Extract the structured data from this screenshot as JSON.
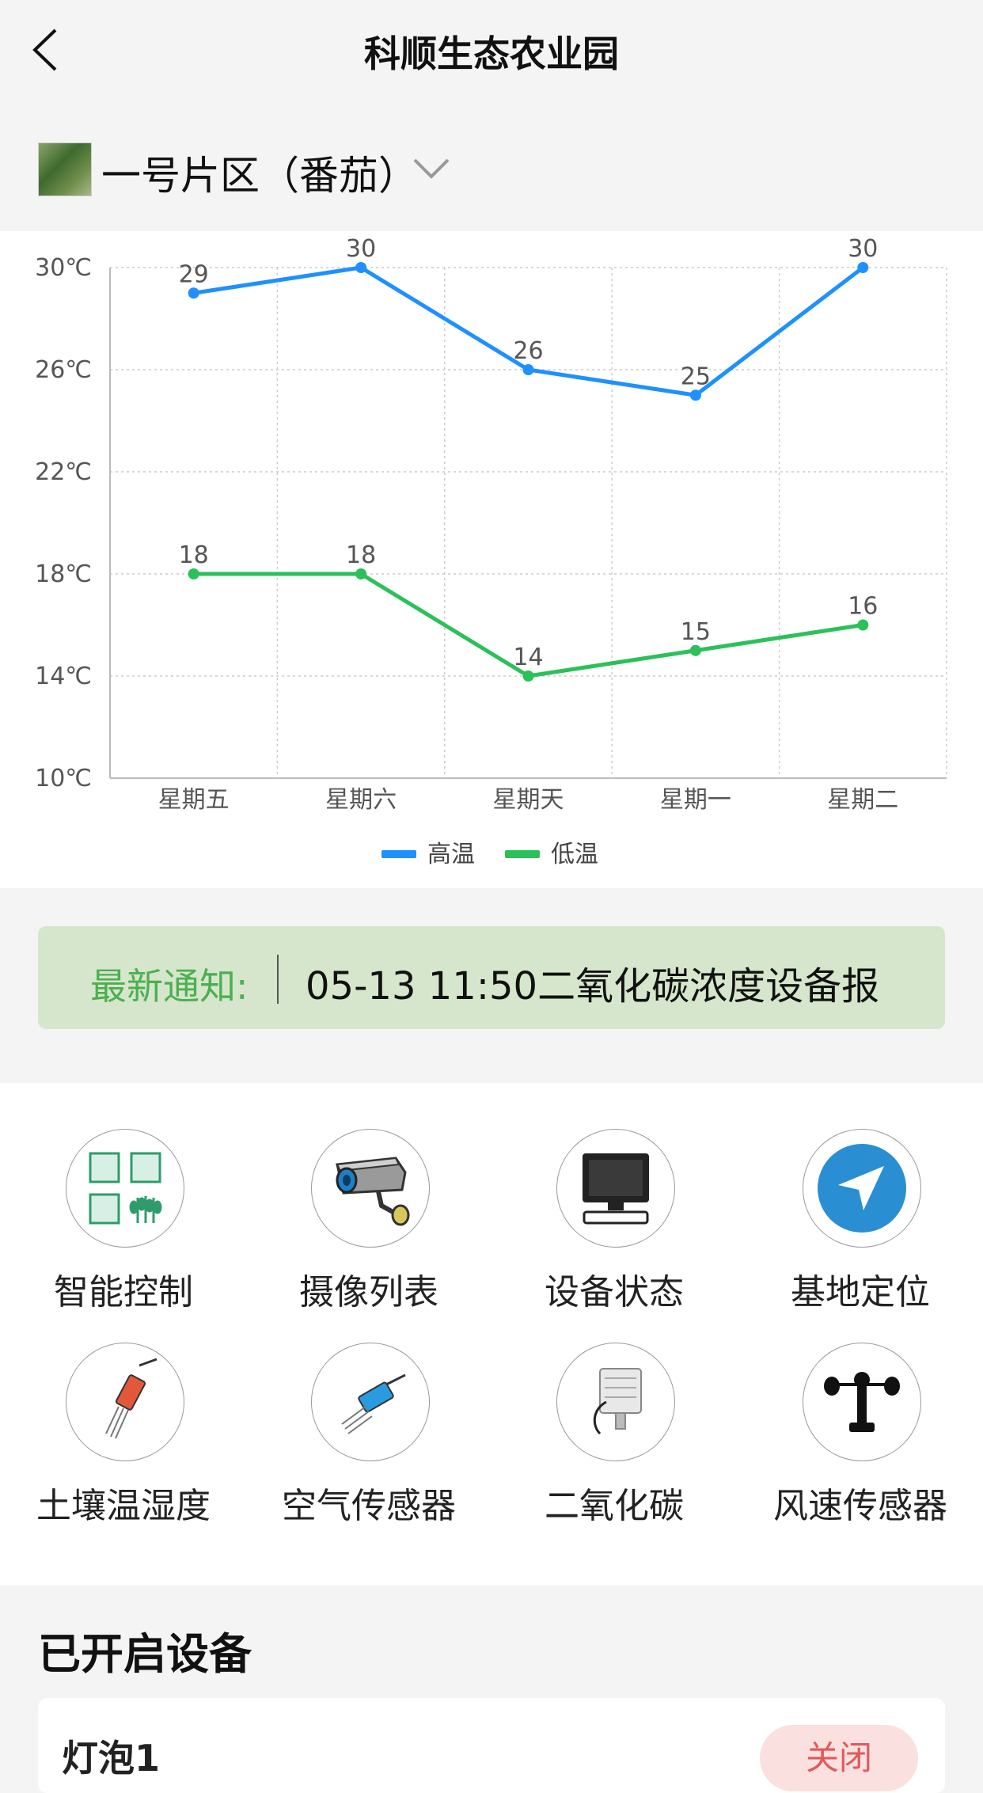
{
  "header": {
    "title": "科顺生态农业园"
  },
  "zone": {
    "name": "一号片区（番茄）"
  },
  "chart_data": {
    "type": "line",
    "categories": [
      "星期五",
      "星期六",
      "星期天",
      "星期一",
      "星期二"
    ],
    "series": [
      {
        "name": "高温",
        "values": [
          29,
          30,
          26,
          25,
          30
        ],
        "color": "#1e90ff"
      },
      {
        "name": "低温",
        "values": [
          18,
          18,
          14,
          15,
          16
        ],
        "color": "#2cc05a"
      }
    ],
    "ylim": [
      10,
      30
    ],
    "yticks": [
      10,
      14,
      18,
      22,
      26,
      30
    ],
    "y_tick_labels": [
      "10℃",
      "14℃",
      "18℃",
      "22℃",
      "26℃",
      "30℃"
    ],
    "grid": true,
    "legend_position": "bottom"
  },
  "notice": {
    "label": "最新通知:",
    "text": "05-13 11:50二氧化碳浓度设备报"
  },
  "features": [
    {
      "label": "智能控制",
      "icon": "smart-control-icon"
    },
    {
      "label": "摄像列表",
      "icon": "camera-icon"
    },
    {
      "label": "设备状态",
      "icon": "monitor-icon"
    },
    {
      "label": "基地定位",
      "icon": "location-arrow-icon"
    },
    {
      "label": "土壤温湿度",
      "icon": "soil-sensor-icon"
    },
    {
      "label": "空气传感器",
      "icon": "air-sensor-icon"
    },
    {
      "label": "二氧化碳",
      "icon": "co2-sensor-icon"
    },
    {
      "label": "风速传感器",
      "icon": "anemometer-icon"
    }
  ],
  "devices": {
    "title": "已开启设备",
    "items": [
      {
        "name": "灯泡1",
        "action": "关闭"
      }
    ]
  }
}
